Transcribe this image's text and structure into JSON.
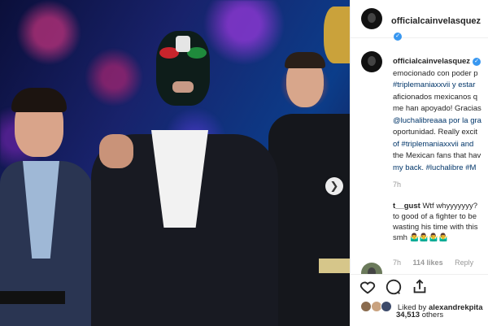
{
  "post": {
    "username": "officialcainvelasquez",
    "caption_lines": [
      "emocionado con poder p",
      "#triplemaniaxxvii y estar",
      "aficionados mexicanos q",
      "me han apoyado! Gracias",
      "@luchalibreaaa por la gra",
      "oportunidad. Really excit",
      "of #triplemaniaxxvii and",
      "the Mexican fans that hav",
      "my back. #luchalibre #M"
    ],
    "caption_first_partial": "",
    "caption_time": "7h"
  },
  "comment": {
    "username": "t__gust",
    "lines": [
      "Wtf whyyyyyyy?",
      "to good of a fighter to be",
      "wasting his time with this",
      "smh 🤷‍♂️🤷‍♂️🤷‍♂️🤷‍♂️"
    ],
    "time": "7h",
    "likes": "114 likes",
    "reply": "Reply"
  },
  "likes": {
    "liked_by_prefix": "Liked by",
    "liked_by_user": "alexandrekpita",
    "count": "34,513",
    "count_suffix": "others"
  },
  "icons": {
    "next": "chevron-right-icon",
    "like": "heart-icon",
    "comment": "comment-icon",
    "share": "share-icon",
    "verified": "verified-badge-icon"
  },
  "colors": {
    "verified": "#3897f0",
    "hashtag": "#003569",
    "muted": "#999999"
  }
}
